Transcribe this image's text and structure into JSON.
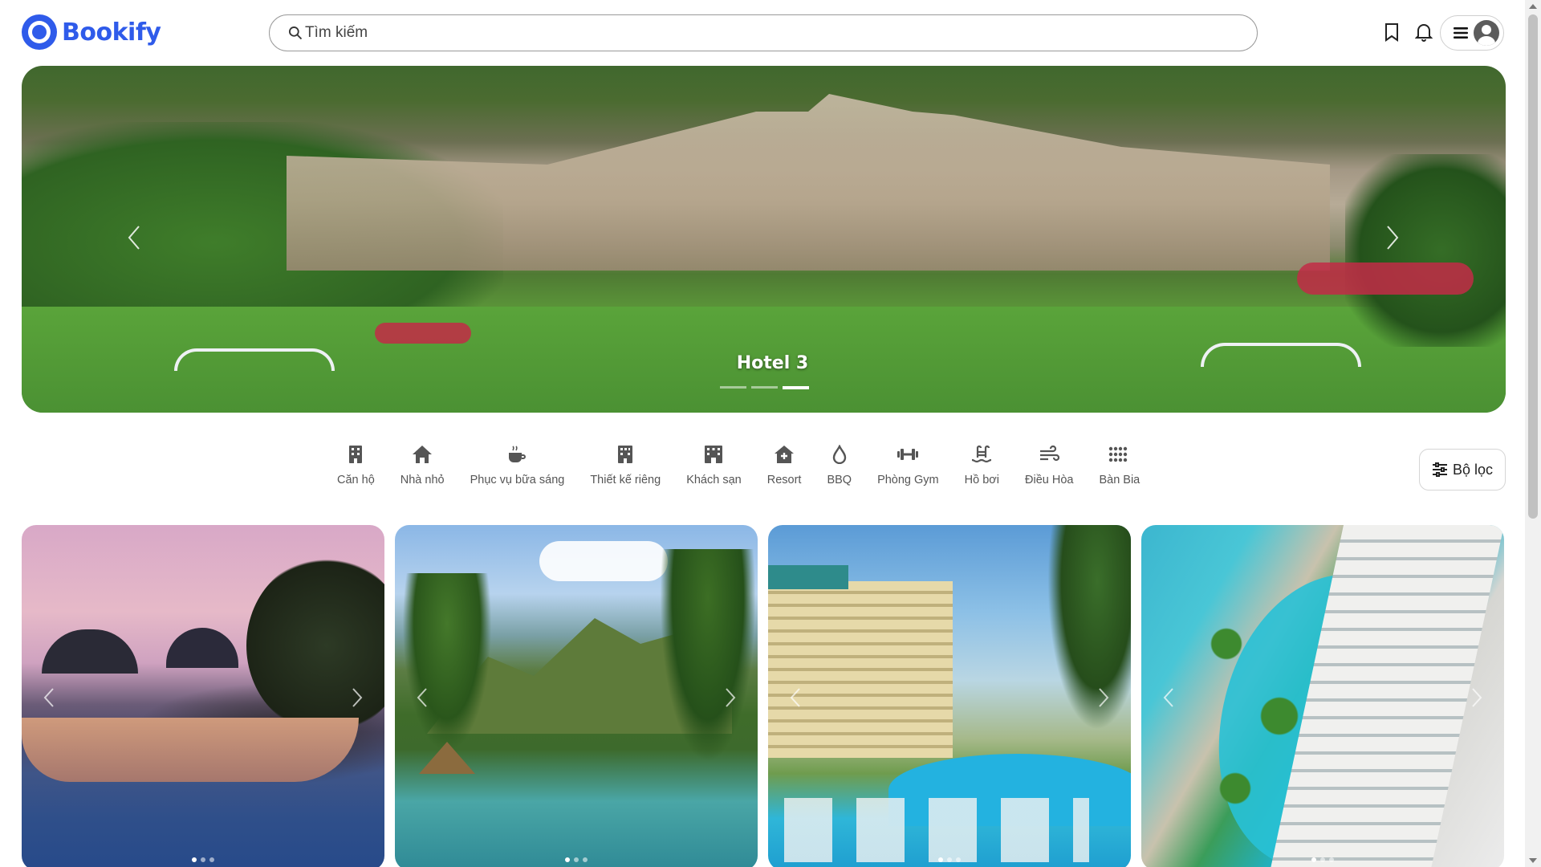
{
  "app": {
    "logo_text": "Bookify",
    "brand_color": "#2f5bea"
  },
  "search": {
    "placeholder": "Tìm kiếm",
    "value": ""
  },
  "header": {
    "icons": [
      "bookmark-icon",
      "bell-icon",
      "menu-icon",
      "user-avatar-icon"
    ]
  },
  "hero": {
    "title": "Hotel 3",
    "slide_count": 3,
    "active_slide": 3
  },
  "categories": [
    {
      "label": "Căn hộ",
      "icon": "apartment-icon"
    },
    {
      "label": "Nhà nhỏ",
      "icon": "house-icon"
    },
    {
      "label": "Phục vụ bữa sáng",
      "icon": "coffee-icon"
    },
    {
      "label": "Thiết kế riêng",
      "icon": "custom-building-icon"
    },
    {
      "label": "Khách sạn",
      "icon": "hotel-icon"
    },
    {
      "label": "Resort",
      "icon": "resort-icon"
    },
    {
      "label": "BBQ",
      "icon": "flame-icon"
    },
    {
      "label": "Phòng Gym",
      "icon": "dumbbell-icon"
    },
    {
      "label": "Hồ bơi",
      "icon": "pool-icon"
    },
    {
      "label": "Điều Hòa",
      "icon": "air-conditioner-icon"
    },
    {
      "label": "Bàn Bia",
      "icon": "grid-dots-icon"
    }
  ],
  "filter": {
    "label": "Bộ lọc",
    "icon": "sliders-icon"
  },
  "listings": [
    {
      "image": "sunset-island-terrace",
      "slide_count": 3,
      "active_slide": 1
    },
    {
      "image": "tropical-pool-mountains",
      "slide_count": 3,
      "active_slide": 1
    },
    {
      "image": "hotel-pool-palms",
      "slide_count": 3,
      "active_slide": 1
    },
    {
      "image": "aerial-resort-pool",
      "slide_count": 3,
      "active_slide": 1
    }
  ]
}
